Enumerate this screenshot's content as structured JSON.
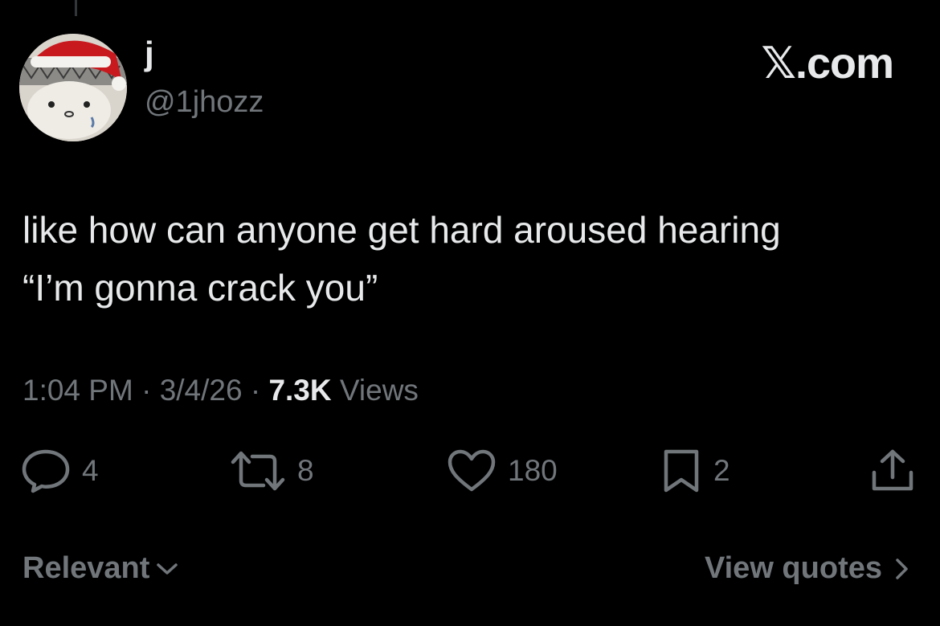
{
  "post": {
    "author": {
      "display_name": "j",
      "handle": "@1jhozz"
    },
    "brand": "𝕏.com",
    "text": "like how can anyone get hard aroused hearing\n“I’m gonna crack you”",
    "timestamp": {
      "time": "1:04 PM",
      "date": "3/4/26",
      "separator": "·",
      "views_count": "7.3K",
      "views_label": "Views"
    },
    "actions": {
      "replies": "4",
      "reposts": "8",
      "likes": "180",
      "bookmarks": "2"
    }
  },
  "footer": {
    "sort_label": "Relevant",
    "quotes_label": "View quotes"
  },
  "colors": {
    "background": "#000000",
    "primary_text": "#e7e9ea",
    "secondary_text": "#71767b"
  },
  "icons": {
    "reply": "reply-icon",
    "repost": "repost-icon",
    "like": "heart-icon",
    "bookmark": "bookmark-icon",
    "share": "share-icon",
    "sort": "chevron-down-icon",
    "quotes": "chevron-right-icon"
  }
}
